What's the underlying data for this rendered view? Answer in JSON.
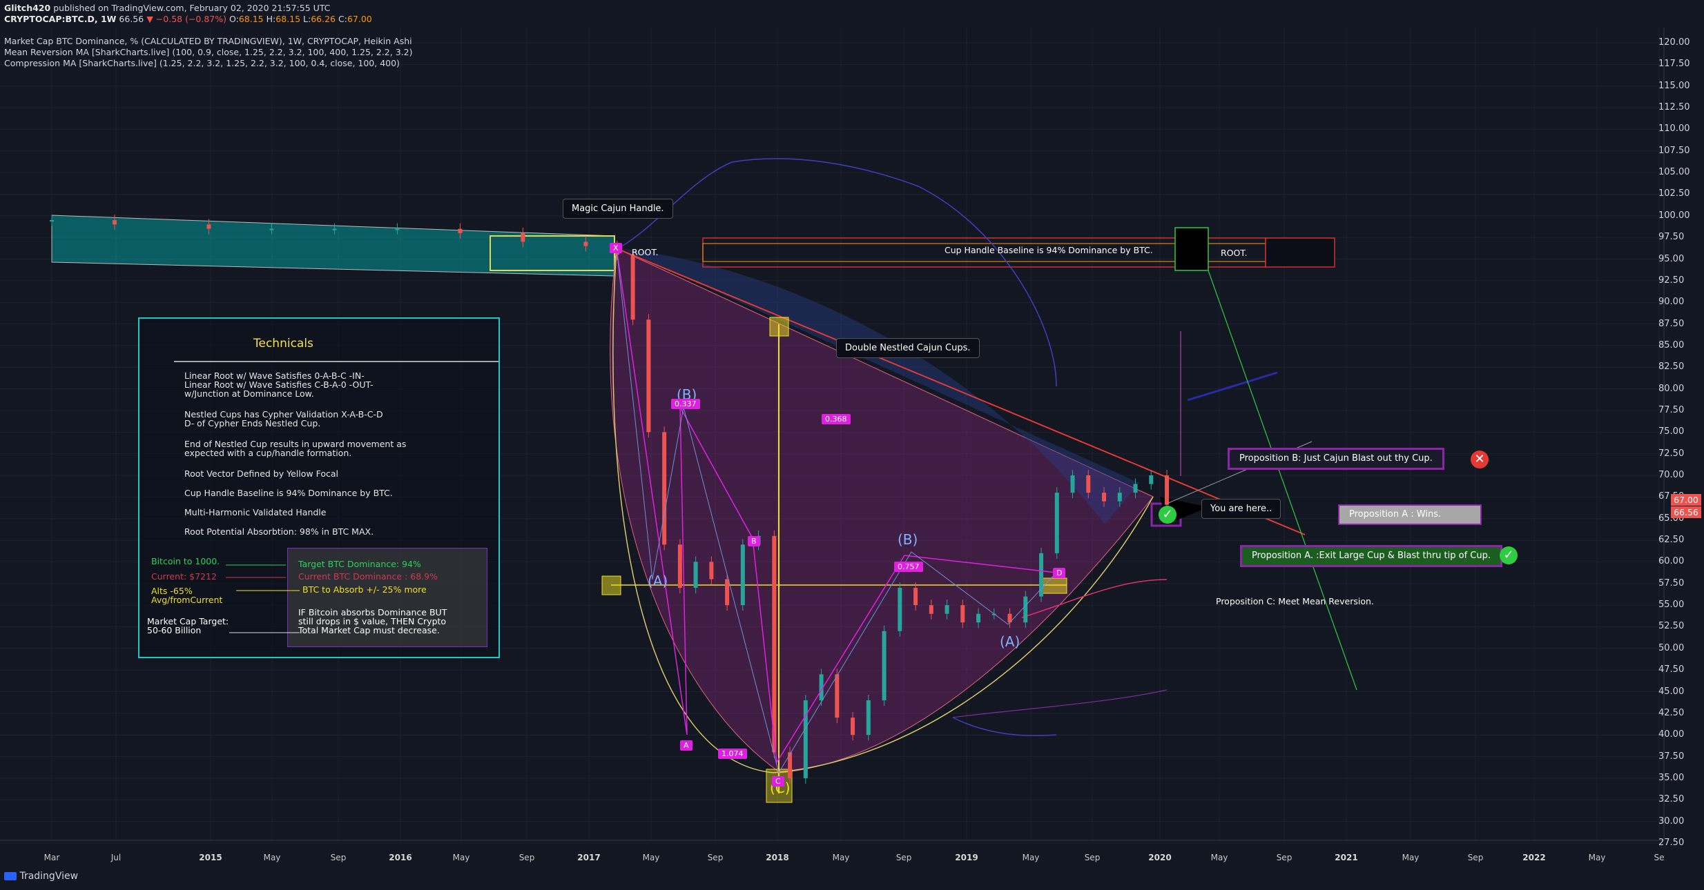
{
  "header": {
    "author": "Glitch420",
    "published": "published on TradingView.com, February 02, 2020 21:57:55 UTC",
    "symbol": "CRYPTOCAP:BTC.D, 1W",
    "last": "66.56",
    "change": "▼ −0.58 (−0.87%)",
    "o_label": "O:",
    "o": "68.15",
    "h_label": "H:",
    "h": "68.15",
    "l_label": "L:",
    "l": "66.26",
    "c_label": "C:",
    "c": "67.00",
    "title": "Market Cap BTC Dominance, % (CALCULATED BY TRADINGVIEW), 1W, CRYPTOCAP, Heikin Ashi",
    "indicator1": "Mean Reversion MA [SharkCharts.live] (100, 0.9, close, 1.25, 2.2, 3.2, 100, 400, 1.25, 2.2, 3.2)",
    "indicator2": "Compression MA [SharkCharts.live] (1.25, 2.2, 3.2, 1.25, 2.2, 3.2, 100, 0.4, close, 100, 400)"
  },
  "price_axis": {
    "ticks": [
      "120.00",
      "117.50",
      "115.00",
      "112.50",
      "110.00",
      "107.50",
      "105.00",
      "102.50",
      "100.00",
      "97.50",
      "95.00",
      "92.50",
      "90.00",
      "87.50",
      "85.00",
      "82.50",
      "80.00",
      "77.50",
      "75.00",
      "72.50",
      "70.00",
      "67.50",
      "65.00",
      "62.50",
      "60.00",
      "57.50",
      "55.00",
      "52.50",
      "50.00",
      "47.50",
      "45.00",
      "42.50",
      "40.00",
      "37.50",
      "35.00",
      "32.50",
      "30.00",
      "27.50"
    ],
    "current_price": "67.00",
    "last_price": "66.56"
  },
  "time_axis": {
    "ticks": [
      "Mar",
      "Jul",
      "2015",
      "May",
      "Sep",
      "2016",
      "May",
      "Sep",
      "2017",
      "May",
      "Sep",
      "2018",
      "May",
      "Sep",
      "2019",
      "May",
      "Sep",
      "2020",
      "May",
      "Sep",
      "2021",
      "May",
      "Sep",
      "2022",
      "May",
      "Se"
    ]
  },
  "technicals": {
    "title": "Technicals",
    "lines": [
      "Linear Root w/ Wave Satisfies 0-A-B-C -IN-\nLinear Root w/ Wave Satisfies C-B-A-0 -OUT-\nw/Junction at Dominance Low.",
      "Nestled Cups has Cypher Validation X-A-B-C-D\nD- of Cypher Ends Nestled Cup.",
      "End of Nestled Cup results in upward movement as\nexpected with a cup/handle formation.",
      "Root Vector Defined by Yellow Focal",
      "Cup Handle Baseline is 94% Dominance by BTC.",
      "Multi-Harmonic Validated Handle",
      "Root Potential Absorbtion: 98% in BTC MAX."
    ],
    "left_notes": {
      "btc_1000": "Bitcoin to 1000.",
      "current": "Current: $7212",
      "alts": "Alts -65%\nAvg/fromCurrent",
      "mcap": "Market Cap Target:\n50-60 Billion"
    },
    "right_notes": {
      "target": "Target BTC Dominance: 94%",
      "current_dom": "Current BTC Dominance : 68.9%",
      "absorb": "BTC to Absorb +/- 25% more",
      "if": "IF Bitcoin absorbs Dominance BUT\nstill drops in $ value, THEN Crypto\nTotal Market Cap must decrease."
    }
  },
  "callouts": {
    "magic": "Magic Cajun Handle.",
    "double": "Double Nestled Cajun Cups.",
    "here": "You are here..",
    "root1": "ROOT.",
    "root2": "ROOT.",
    "baseline": "Cup Handle Baseline is 94% Dominance by BTC."
  },
  "propositions": {
    "b": "Proposition B: Just Cajun Blast out thy Cup.",
    "a_wins": "Proposition A : Wins.",
    "a": "Proposition A. :Exit Large Cup & Blast thru tip of Cup.",
    "c": "Proposition C: Meet Mean Reversion."
  },
  "pattern_labels": {
    "b_wave_top": "(B)",
    "a_wave_left": "(A)",
    "c_wave": "(C)",
    "b_wave_right": "(B)",
    "a_wave_right": "(A)",
    "r1": "0.337",
    "r2": "0.368",
    "r3": "0.757",
    "r4": "1.074",
    "pt_a": "A",
    "pt_b": "B",
    "pt_c": "C",
    "pt_d": "D",
    "pt_x": "X"
  },
  "footer": {
    "brand": "TradingView"
  },
  "chart_data": {
    "type": "line",
    "title": "Market Cap BTC Dominance, % (CALCULATED BY TRADINGVIEW), 1W, CRYPTOCAP, Heikin Ashi",
    "xlabel": "",
    "ylabel": "",
    "ylim": [
      27.5,
      120
    ],
    "x": [
      "2014-03",
      "2014-07",
      "2015-01",
      "2015-05",
      "2015-09",
      "2016-01",
      "2016-05",
      "2016-09",
      "2017-01",
      "2017-03",
      "2017-04",
      "2017-05",
      "2017-06",
      "2017-07",
      "2017-08",
      "2017-09",
      "2017-10",
      "2017-11",
      "2017-12",
      "2018-01",
      "2018-02",
      "2018-03",
      "2018-04",
      "2018-05",
      "2018-06",
      "2018-07",
      "2018-08",
      "2018-09",
      "2018-10",
      "2018-11",
      "2018-12",
      "2019-01",
      "2019-02",
      "2019-03",
      "2019-04",
      "2019-05",
      "2019-06",
      "2019-07",
      "2019-08",
      "2019-09",
      "2019-10",
      "2019-11",
      "2019-12",
      "2020-01",
      "2020-02"
    ],
    "series": [
      {
        "values": [
          99.5,
          99.0,
          98.5,
          98.5,
          98.5,
          98.5,
          98.0,
          97.0,
          96.5,
          95.5,
          88,
          75,
          62,
          57,
          60,
          58,
          55,
          62,
          63,
          38,
          35,
          44,
          47,
          42,
          40,
          44,
          52,
          57,
          55,
          54,
          55,
          53,
          54,
          54,
          53,
          56,
          61,
          68,
          70,
          68,
          67,
          68,
          69,
          70,
          66.6
        ]
      }
    ]
  }
}
